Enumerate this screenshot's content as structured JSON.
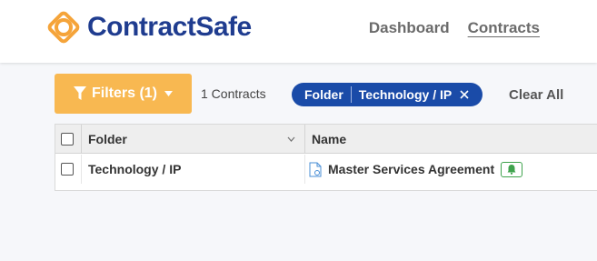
{
  "app": {
    "name": "ContractSafe"
  },
  "nav": [
    {
      "label": "Dashboard",
      "active": false
    },
    {
      "label": "Contracts",
      "active": true
    }
  ],
  "toolbar": {
    "filters_label": "Filters (1)",
    "count_text": "1 Contracts",
    "chip": {
      "key": "Folder",
      "value": "Technology / IP"
    },
    "clear_label": "Clear All"
  },
  "table": {
    "columns": [
      {
        "label": "Folder",
        "sortable": true
      },
      {
        "label": "Name"
      }
    ],
    "rows": [
      {
        "folder": "Technology / IP",
        "name": "Master Services Agreement"
      }
    ]
  },
  "colors": {
    "brand_blue": "#1f3c8f",
    "filters_orange": "#f8b851",
    "chip_blue": "#1a4ba8",
    "badge_green": "#3fa34d",
    "logo_orange": "#f5a43a"
  }
}
